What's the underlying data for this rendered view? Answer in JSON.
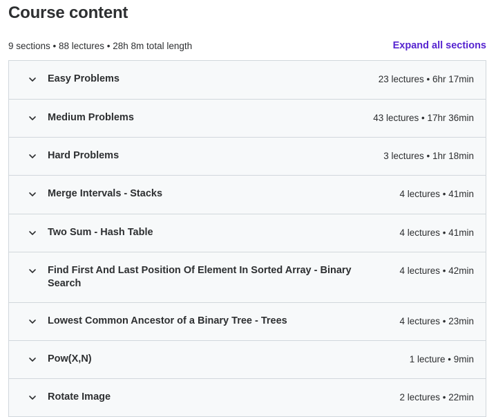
{
  "header": {
    "title": "Course content",
    "summary": "9 sections • 88 lectures • 28h 8m total length",
    "expand_label": "Expand all sections"
  },
  "sections": [
    {
      "title": "Easy Problems",
      "meta": "23 lectures • 6hr 17min"
    },
    {
      "title": "Medium Problems",
      "meta": "43 lectures • 17hr 36min"
    },
    {
      "title": "Hard Problems",
      "meta": "3 lectures • 1hr 18min"
    },
    {
      "title": "Merge Intervals - Stacks",
      "meta": "4 lectures • 41min"
    },
    {
      "title": "Two Sum - Hash Table",
      "meta": "4 lectures • 41min"
    },
    {
      "title": "Find First And Last Position Of Element In Sorted Array - Binary Search",
      "meta": "4 lectures • 42min"
    },
    {
      "title": "Lowest Common Ancestor of a Binary Tree - Trees",
      "meta": "4 lectures • 23min"
    },
    {
      "title": "Pow(X,N)",
      "meta": "1 lecture • 9min"
    },
    {
      "title": "Rotate Image",
      "meta": "2 lectures • 22min"
    }
  ],
  "icons": {
    "chevron": "chevron-down-icon"
  },
  "colors": {
    "accent": "#5624d0",
    "row_bg": "#f7f9fa",
    "border": "#d1d7dc",
    "text": "#2d2f31"
  }
}
